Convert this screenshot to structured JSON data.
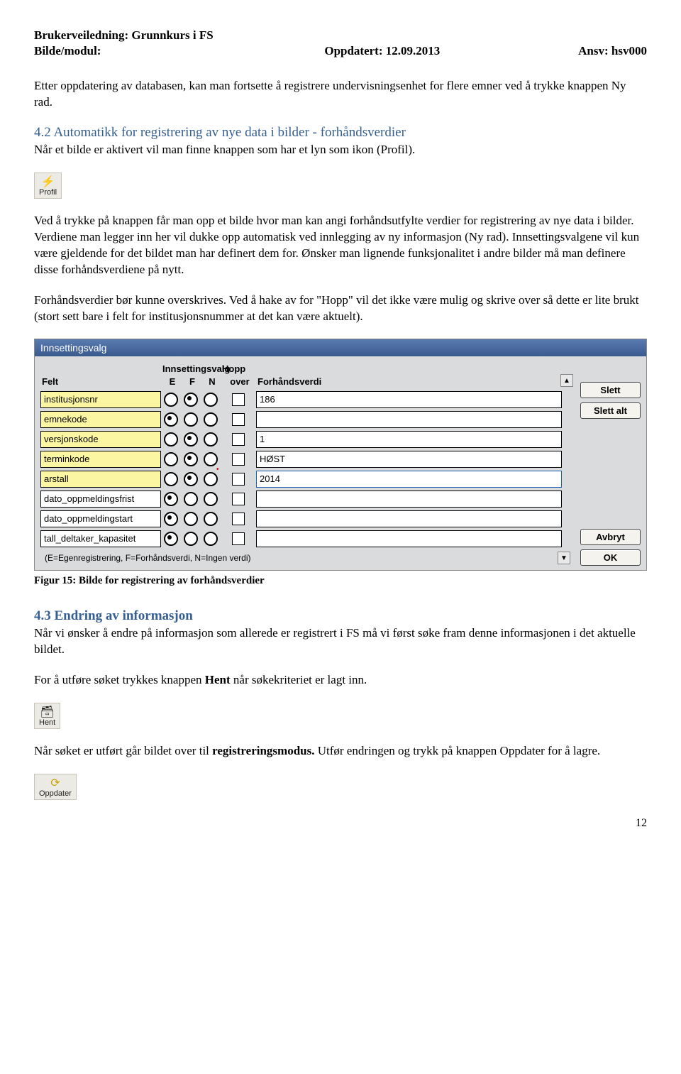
{
  "header": {
    "line1": "Brukerveiledning: Grunnkurs i FS",
    "line2_left": "Bilde/modul:",
    "line2_mid": "Oppdatert: 12.09.2013",
    "line2_right": "Ansv: hsv000"
  },
  "para1": "Etter oppdatering av databasen, kan man fortsette å registrere undervisningsenhet for flere emner ved å trykke knappen Ny rad.",
  "sec42": {
    "title": "4.2 Automatikk for registrering av nye data i bilder - forhåndsverdier",
    "p1": "Når et bilde er aktivert vil man finne knappen som har et lyn som ikon (Profil)."
  },
  "icon_profil": {
    "label": "Profil"
  },
  "para2": "Ved å trykke på knappen får man opp et bilde hvor man kan angi forhåndsutfylte verdier for registrering av nye data i bilder. Verdiene man legger inn her vil dukke opp automatisk ved innlegging av ny informasjon (Ny rad). Innsettingsvalgene vil kun være gjeldende for det bildet man har definert dem for. Ønsker man lignende funksjonalitet i andre bilder må man definere disse forhåndsverdiene på nytt.",
  "para3": "Forhåndsverdier bør kunne overskrives. Ved å hake av for \"Hopp\" vil det ikke være mulig og skrive over så dette er lite brukt (stort sett bare i felt for institusjonsnummer at det kan være aktuelt).",
  "dialog": {
    "title": "Innsettingsvalg",
    "h_felt": "Felt",
    "h_inns": "Innsettingsvalg",
    "h_e": "E",
    "h_f": "F",
    "h_n": "N",
    "h_hopp": "Hopp",
    "h_over": "over",
    "h_forh": "Forhåndsverdi",
    "legend": "(E=Egenregistrering, F=Forhåndsverdi, N=Ingen verdi)",
    "buttons": {
      "slett": "Slett",
      "slett_alt": "Slett alt",
      "avbryt": "Avbryt",
      "ok": "OK"
    },
    "rows": [
      {
        "felt": "institusjonsnr",
        "req": true,
        "sel": "F",
        "hopp": false,
        "verdi": "186"
      },
      {
        "felt": "emnekode",
        "req": true,
        "sel": "E",
        "hopp": false,
        "verdi": ""
      },
      {
        "felt": "versjonskode",
        "req": true,
        "sel": "F",
        "hopp": false,
        "verdi": "1"
      },
      {
        "felt": "terminkode",
        "req": true,
        "sel": "F",
        "hopp": false,
        "verdi": "HØST"
      },
      {
        "felt": "arstall",
        "req": true,
        "sel": "F",
        "hopp": false,
        "verdi": "2014",
        "active": true,
        "marker": true
      },
      {
        "felt": "dato_oppmeldingsfrist",
        "req": false,
        "sel": "E",
        "hopp": false,
        "verdi": ""
      },
      {
        "felt": "dato_oppmeldingstart",
        "req": false,
        "sel": "E",
        "hopp": false,
        "verdi": ""
      },
      {
        "felt": "tall_deltaker_kapasitet",
        "req": false,
        "sel": "E",
        "hopp": false,
        "verdi": ""
      }
    ]
  },
  "fig15": "Figur 15: Bilde for registrering av forhåndsverdier",
  "sec43": {
    "title": "4.3 Endring av informasjon",
    "p1": "Når vi ønsker å endre på informasjon som allerede er registrert i FS må vi først søke fram denne informasjonen i det aktuelle bildet.",
    "p2a": "For å utføre søket trykkes knappen ",
    "p2b": "Hent",
    "p2c": " når søkekriteriet er lagt inn."
  },
  "icon_hent": {
    "label": "Hent"
  },
  "para4a": "Når søket er utført går bildet over til ",
  "para4b": "registreringsmodus.",
  "para4c": " Utfør endringen og trykk på knappen Oppdater for å lagre.",
  "icon_oppdater": {
    "label": "Oppdater"
  },
  "pagenum": "12"
}
